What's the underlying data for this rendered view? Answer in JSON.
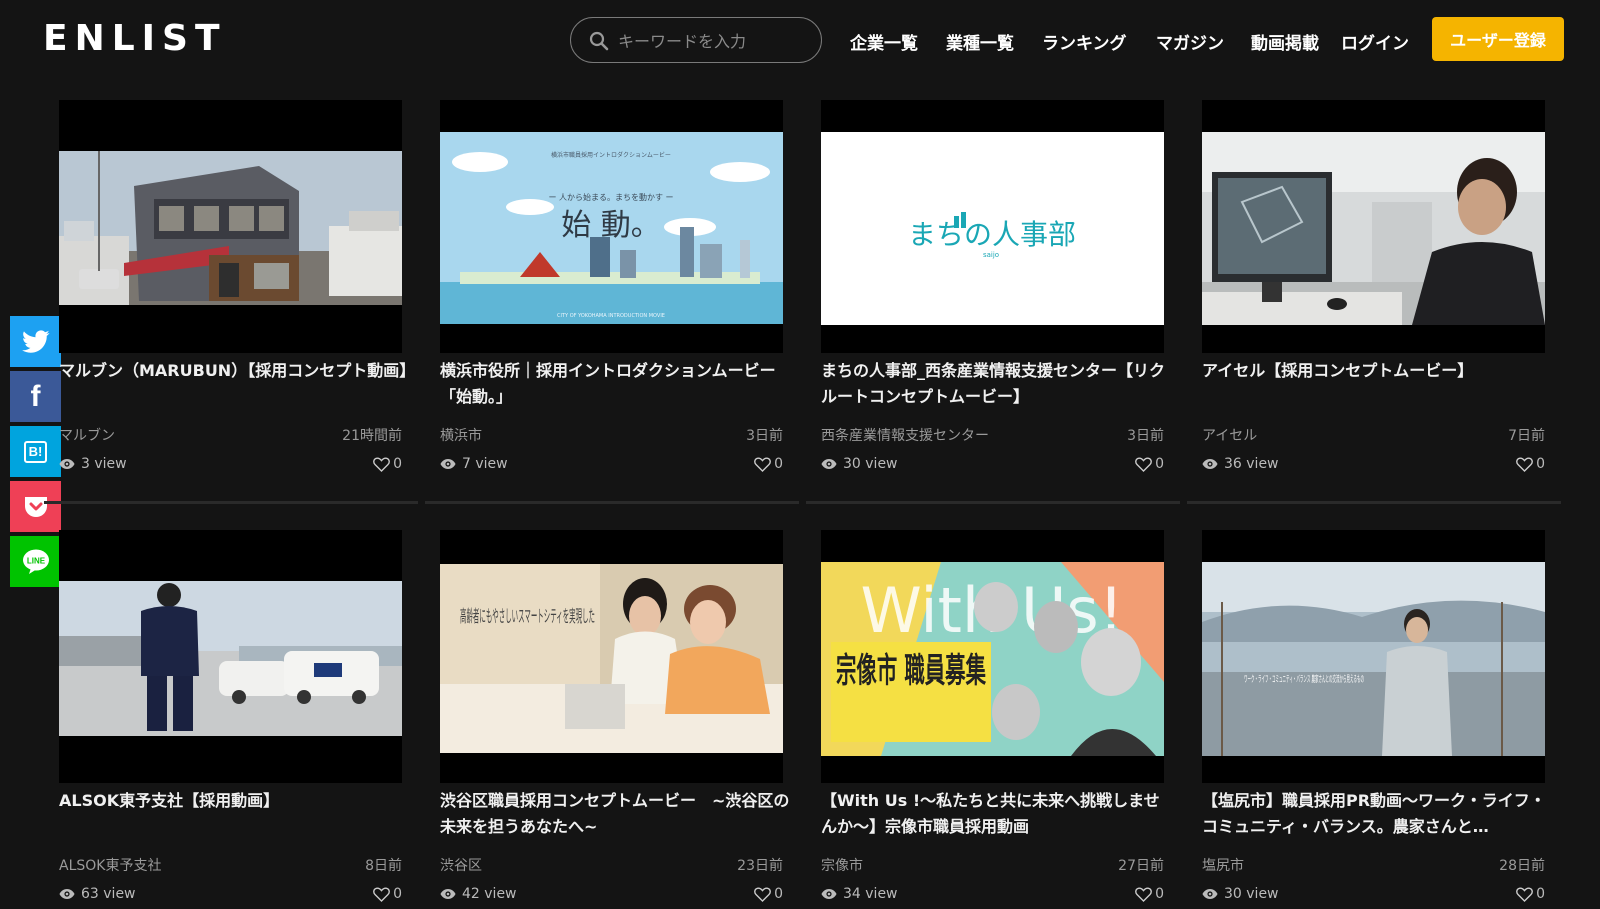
{
  "header": {
    "logo": "ENLIST",
    "search_placeholder": "キーワードを入力",
    "nav": [
      "企業一覧",
      "業種一覧",
      "ランキング",
      "マガジン",
      "動画掲載",
      "ログイン"
    ],
    "register": "ユーザー登録"
  },
  "share": [
    {
      "name": "twitter",
      "color": "#1da1f2"
    },
    {
      "name": "facebook",
      "color": "#3b5998"
    },
    {
      "name": "hatena",
      "color": "#00a4de"
    },
    {
      "name": "pocket",
      "color": "#ef4056"
    },
    {
      "name": "line",
      "color": "#00c300"
    }
  ],
  "videos": [
    {
      "title": "マルブン（MARUBUN）【採用コンセプト動画】",
      "org": "マルブン",
      "ago": "21時間前",
      "views": "3 view",
      "likes": "0"
    },
    {
      "title": "横浜市役所｜採用イントロダクションムービー「始動。」",
      "org": "横浜市",
      "ago": "3日前",
      "views": "7 view",
      "likes": "0",
      "thumb_heading": "始 動。",
      "thumb_caption": "ー 人から始まる。まちを動かす ー"
    },
    {
      "title": "まちの人事部_西条産業情報支援センター【リクルートコンセプトムービー】",
      "org": "西条産業情報支援センター",
      "ago": "3日前",
      "views": "30 view",
      "likes": "0",
      "thumb_heading": "まちの人事部",
      "thumb_caption": "saijo"
    },
    {
      "title": "アイセル【採用コンセプトムービー】",
      "org": "アイセル",
      "ago": "7日前",
      "views": "36 view",
      "likes": "0"
    },
    {
      "title": "ALSOK東予支社【採用動画】",
      "org": "ALSOK東予支社",
      "ago": "8日前",
      "views": "63 view",
      "likes": "0"
    },
    {
      "title": "渋谷区職員採用コンセプトムービー　~渋谷区の未来を担うあなたへ~",
      "org": "渋谷区",
      "ago": "23日前",
      "views": "42 view",
      "likes": "0",
      "thumb_heading": "高齢者にもやさしいスマートシティを実現した"
    },
    {
      "title": "【With Us !～私たちと共に未来へ挑戦しませんか～】宗像市職員採用動画",
      "org": "宗像市",
      "ago": "27日前",
      "views": "34 view",
      "likes": "0",
      "thumb_heading": "With Us!",
      "thumb_caption": "宗像市 職員募集"
    },
    {
      "title": "【塩尻市】職員採用PR動画～ワーク・ライフ・コミュニティ・バランス。農家さんと…",
      "org": "塩尻市",
      "ago": "28日前",
      "views": "30 view",
      "likes": "0",
      "thumb_heading": "ワーク・ライフ・コミュニティ・バランス 農家さんとの交流から見えるもの"
    }
  ]
}
